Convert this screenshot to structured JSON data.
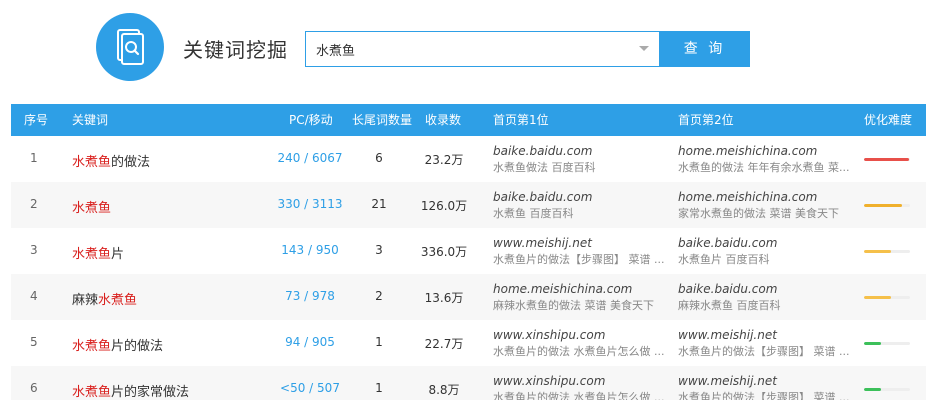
{
  "header": {
    "title": "关键词挖掘",
    "logo_icon": "keyword-search-icon"
  },
  "search": {
    "value": "水煮鱼",
    "button_label": "查 询"
  },
  "table": {
    "columns": [
      "序号",
      "关键词",
      "PC/移动",
      "长尾词数量",
      "收录数",
      "首页第1位",
      "首页第2位",
      "优化难度"
    ],
    "rows": [
      {
        "index": "1",
        "keyword_parts": [
          {
            "text": "水煮鱼",
            "highlight": true
          },
          {
            "text": "的做法",
            "highlight": false
          }
        ],
        "pc_mobile": "240 / 6067",
        "longtail": "6",
        "indexed": "23.2万",
        "rank1": {
          "domain": "baike.baidu.com",
          "snippet": "水煮鱼做法  百度百科"
        },
        "rank2": {
          "domain": "home.meishichina.com",
          "snippet": "水煮鱼的做法  年年有余水煮鱼  菜..."
        },
        "difficulty": 0.98,
        "difficulty_color": "#e8504a"
      },
      {
        "index": "2",
        "keyword_parts": [
          {
            "text": "水煮鱼",
            "highlight": true
          }
        ],
        "pc_mobile": "330 / 3113",
        "longtail": "21",
        "indexed": "126.0万",
        "rank1": {
          "domain": "baike.baidu.com",
          "snippet": "水煮鱼  百度百科"
        },
        "rank2": {
          "domain": "home.meishichina.com",
          "snippet": "家常水煮鱼的做法  菜谱  美食天下"
        },
        "difficulty": 0.82,
        "difficulty_color": "#f0b02c"
      },
      {
        "index": "3",
        "keyword_parts": [
          {
            "text": "水煮鱼",
            "highlight": true
          },
          {
            "text": "片",
            "highlight": false
          }
        ],
        "pc_mobile": "143 / 950",
        "longtail": "3",
        "indexed": "336.0万",
        "rank1": {
          "domain": "www.meishij.net",
          "snippet": "水煮鱼片的做法【步骤图】  菜谱 ..."
        },
        "rank2": {
          "domain": "baike.baidu.com",
          "snippet": "水煮鱼片  百度百科"
        },
        "difficulty": 0.58,
        "difficulty_color": "#f5c04a"
      },
      {
        "index": "4",
        "keyword_parts": [
          {
            "text": "麻辣",
            "highlight": false
          },
          {
            "text": "水煮鱼",
            "highlight": true
          }
        ],
        "pc_mobile": "73 / 978",
        "longtail": "2",
        "indexed": "13.6万",
        "rank1": {
          "domain": "home.meishichina.com",
          "snippet": "麻辣水煮鱼的做法  菜谱  美食天下"
        },
        "rank2": {
          "domain": "baike.baidu.com",
          "snippet": "麻辣水煮鱼  百度百科"
        },
        "difficulty": 0.58,
        "difficulty_color": "#f5c04a"
      },
      {
        "index": "5",
        "keyword_parts": [
          {
            "text": "水煮鱼",
            "highlight": true
          },
          {
            "text": "片的做法",
            "highlight": false
          }
        ],
        "pc_mobile": "94 / 905",
        "longtail": "1",
        "indexed": "22.7万",
        "rank1": {
          "domain": "www.xinshipu.com",
          "snippet": "水煮鱼片的做法  水煮鱼片怎么做 ..."
        },
        "rank2": {
          "domain": "www.meishij.net",
          "snippet": "水煮鱼片的做法【步骤图】  菜谱 ..."
        },
        "difficulty": 0.38,
        "difficulty_color": "#3cc05a"
      },
      {
        "index": "6",
        "keyword_parts": [
          {
            "text": "水煮鱼",
            "highlight": true
          },
          {
            "text": "片的家常做法",
            "highlight": false
          }
        ],
        "pc_mobile": "<50 / 507",
        "longtail": "1",
        "indexed": "8.8万",
        "rank1": {
          "domain": "www.xinshipu.com",
          "snippet": "水煮鱼片的做法  水煮鱼片怎么做 ..."
        },
        "rank2": {
          "domain": "www.meishij.net",
          "snippet": "水煮鱼片的做法【步骤图】  菜谱 ..."
        },
        "difficulty": 0.36,
        "difficulty_color": "#3cc05a"
      }
    ]
  }
}
